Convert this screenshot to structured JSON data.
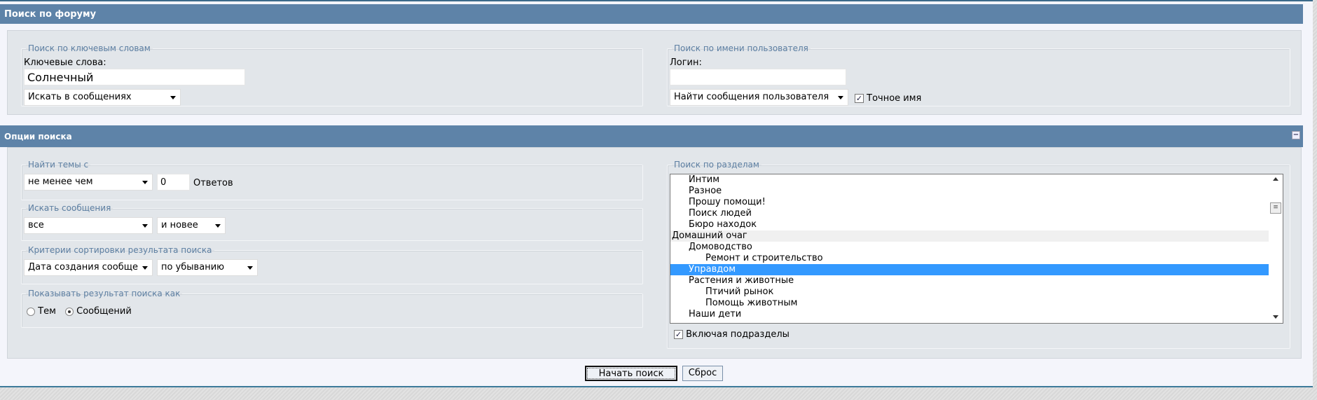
{
  "header": {
    "title": "Поиск по форуму"
  },
  "keywords": {
    "legend": "Поиск по ключевым словам",
    "label": "Ключевые слова:",
    "value": "Солнечный",
    "search_in": "Искать в сообщениях"
  },
  "user": {
    "legend": "Поиск по имени пользователя",
    "label": "Логин:",
    "value": "",
    "find_select": "Найти сообщения пользователя",
    "exact_label": "Точное имя",
    "exact_checked": true
  },
  "options": {
    "title": "Опции поиска",
    "collapse_icon": "minus-icon",
    "topics": {
      "legend": "Найти темы с",
      "condition": "не менее чем",
      "count": "0",
      "unit": "Ответов"
    },
    "messages": {
      "legend": "Искать сообщения",
      "period": "все",
      "direction": "и новее"
    },
    "sort": {
      "legend": "Критерии сортировки результата поиска",
      "field": "Дата создания сообще",
      "order": "по убыванию"
    },
    "show": {
      "legend": "Показывать результат поиска как",
      "topics": "Тем",
      "messages": "Сообщений",
      "selected": "messages"
    },
    "sections": {
      "legend": "Поиск по разделам",
      "items": [
        {
          "label": "Интим",
          "level": 1
        },
        {
          "label": "Разное",
          "level": 1
        },
        {
          "label": "Прошу помощи!",
          "level": 1
        },
        {
          "label": "Поиск людей",
          "level": 1
        },
        {
          "label": "Бюро находок",
          "level": 1
        },
        {
          "label": "Домашний очаг",
          "level": 0
        },
        {
          "label": "Домоводство",
          "level": 1
        },
        {
          "label": "Ремонт и строительство",
          "level": 2
        },
        {
          "label": "Управдом",
          "level": 1,
          "selected": true
        },
        {
          "label": "Растения и животные",
          "level": 1
        },
        {
          "label": "Птичий рынок",
          "level": 2
        },
        {
          "label": "Помощь животным",
          "level": 2
        },
        {
          "label": "Наши дети",
          "level": 1
        }
      ],
      "include_sub": "Включая подразделы",
      "include_checked": true
    }
  },
  "buttons": {
    "search": "Начать поиск",
    "reset": "Сброс"
  },
  "colors": {
    "header": "#5e83a8",
    "selected": "#3399ff",
    "panel": "#e2e6ea"
  }
}
